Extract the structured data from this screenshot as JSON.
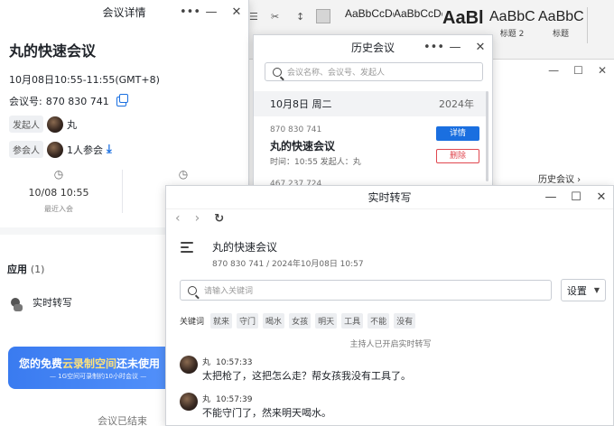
{
  "word": {
    "styles": [
      {
        "sample": "AaBbCcDc",
        "label": ""
      },
      {
        "sample": "AaBbCcDc",
        "label": ""
      },
      {
        "sample": "AaBl",
        "label": ""
      },
      {
        "sample": "AaBbC",
        "label": "标题 2"
      },
      {
        "sample": "AaBbC",
        "label": "标题"
      }
    ],
    "history_link": "历史会议 ›"
  },
  "detail": {
    "window_title": "会议详情",
    "meeting_title": "丸的快速会议",
    "time_range": "10月08日10:55-11:55(GMT+8)",
    "meeting_id_label": "会议号:",
    "meeting_id": "870 830 741",
    "initiator_tag": "发起人",
    "initiator_name": "丸",
    "participant_tag": "参会人",
    "participant_count": "1人参会",
    "stat_left_value": "10/08 10:55",
    "stat_left_sub": "最近入会",
    "apps_label": "应用",
    "apps_count": "(1)",
    "app_name": "实时转写",
    "banner_main_pre": "您的免费",
    "banner_main_hl": "云录制空间",
    "banner_main_post": "还未使用",
    "banner_sub": "— 1G空间可录制约10小时会议 —",
    "ended_text": "会议已结束"
  },
  "history": {
    "window_title": "历史会议",
    "search_placeholder": "会议名称、会议号、发起人",
    "date": "10月8日 周二",
    "year": "2024年",
    "card_id": "870 830 741",
    "card_title": "丸的快速会议",
    "card_meta": "时间：10:55   发起人：丸",
    "btn_detail": "详情",
    "btn_delete": "删除",
    "next_id": "467 237 724"
  },
  "rt": {
    "window_title": "实时转写",
    "title": "丸的快速会议",
    "subtitle": "870 830 741 / 2024年10月08日 10:57",
    "search_placeholder": "请输入关键词",
    "settings_label": "设置",
    "keywords_label": "关键词",
    "keywords": [
      "就来",
      "守门",
      "喝水",
      "女孩",
      "明天",
      "工具",
      "不能",
      "没有"
    ],
    "notice": "主持人已开启实时转写",
    "messages": [
      {
        "name": "丸",
        "time": "10:57:33",
        "text": "太把枪了，这把怎么走？帮女孩我没有工具了。"
      },
      {
        "name": "丸",
        "time": "10:57:39",
        "text": "不能守门了，然来明天喝水。"
      }
    ]
  }
}
